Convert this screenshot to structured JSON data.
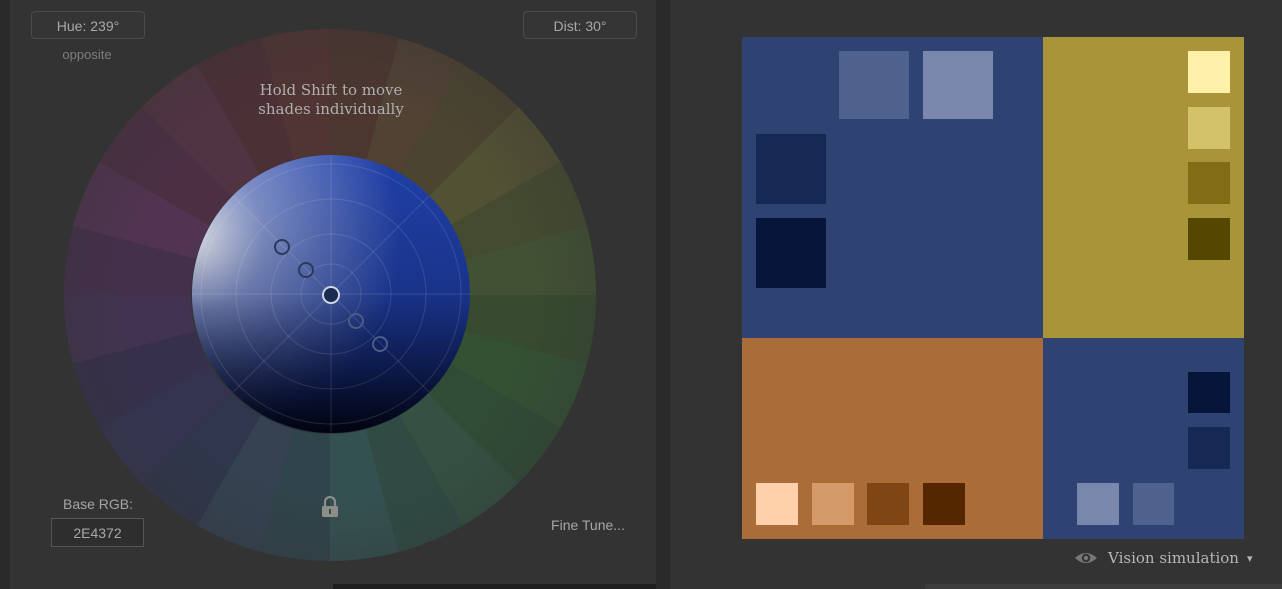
{
  "wheel": {
    "hue_label": "Hue: 239°",
    "dist_label": "Dist: 30°",
    "mode_label": "opposite",
    "hint_line1": "Hold Shift to move",
    "hint_line2": "shades individually",
    "base_rgb_label": "Base RGB:",
    "base_rgb_value": "2E4372",
    "fine_tune_label": "Fine Tune..."
  },
  "vision": {
    "label": "Vision simulation",
    "caret": "▾"
  },
  "colors": {
    "primary": "#2E4372",
    "complement": "#AA9439",
    "triad": "#AA6C39",
    "primary_shades": [
      "#4F628E",
      "#7887AB",
      "#162955",
      "#061539"
    ],
    "complement_shades": [
      "#FFF0AA",
      "#D4C26A",
      "#806D15",
      "#554600"
    ],
    "triad_shades": [
      "#FFD1AA",
      "#D49A6A",
      "#804515",
      "#552700"
    ]
  }
}
